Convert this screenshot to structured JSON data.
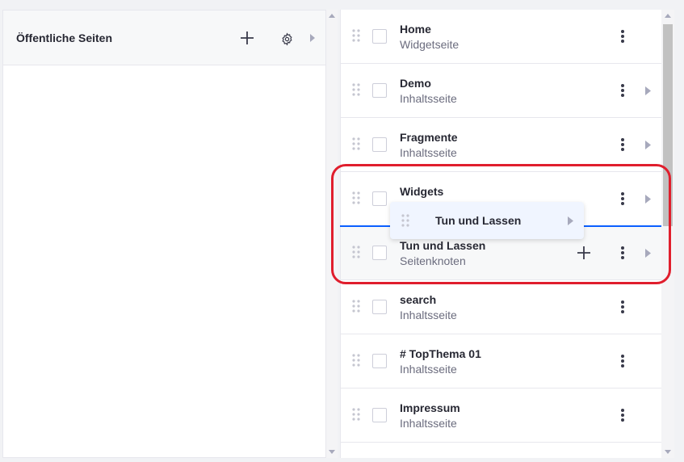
{
  "left_panel": {
    "title": "Öffentliche Seiten",
    "add_icon": "plus-icon",
    "settings_icon": "gear-icon",
    "expand_icon": "caret-right-icon"
  },
  "pages": [
    {
      "name": "Home",
      "type": "Widgetseite",
      "has_children": false
    },
    {
      "name": "Demo",
      "type": "Inhaltsseite",
      "has_children": true
    },
    {
      "name": "Fragmente",
      "type": "Inhaltsseite",
      "has_children": true
    },
    {
      "name": "Widgets",
      "type": "",
      "has_children": true
    },
    {
      "name": "Tun und Lassen",
      "type": "Seitenknoten",
      "has_children": true,
      "hovered": true
    },
    {
      "name": "search",
      "type": "Inhaltsseite",
      "has_children": false
    },
    {
      "name": "# TopThema 01",
      "type": "Inhaltsseite",
      "has_children": false
    },
    {
      "name": "Impressum",
      "type": "Inhaltsseite",
      "has_children": false
    }
  ],
  "drag_preview": {
    "name": "Tun und Lassen"
  },
  "colors": {
    "drop_indicator": "#0b5fff",
    "annotation": "#e01e2d",
    "accent_bg": "#f0f5ff"
  }
}
